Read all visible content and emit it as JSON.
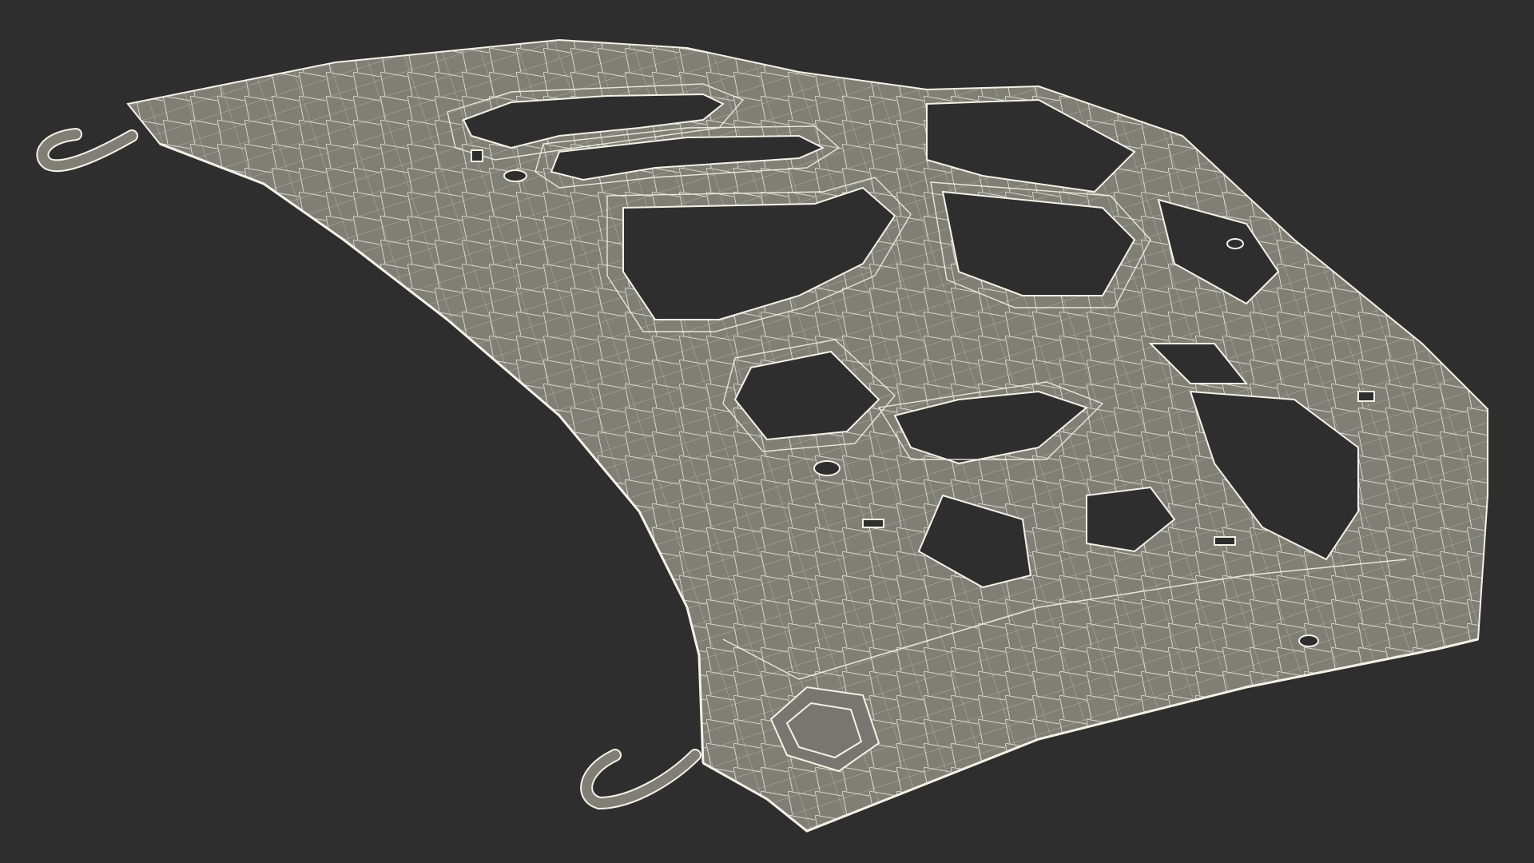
{
  "scene": {
    "subject": "hood-inner-panel-wireframe",
    "colors": {
      "background": "#2e2e2e",
      "surface": "#7f7f76",
      "surface_shade": "#6f6f67",
      "edge": "#f2f2e6",
      "hole": "#2e2e2e"
    }
  }
}
